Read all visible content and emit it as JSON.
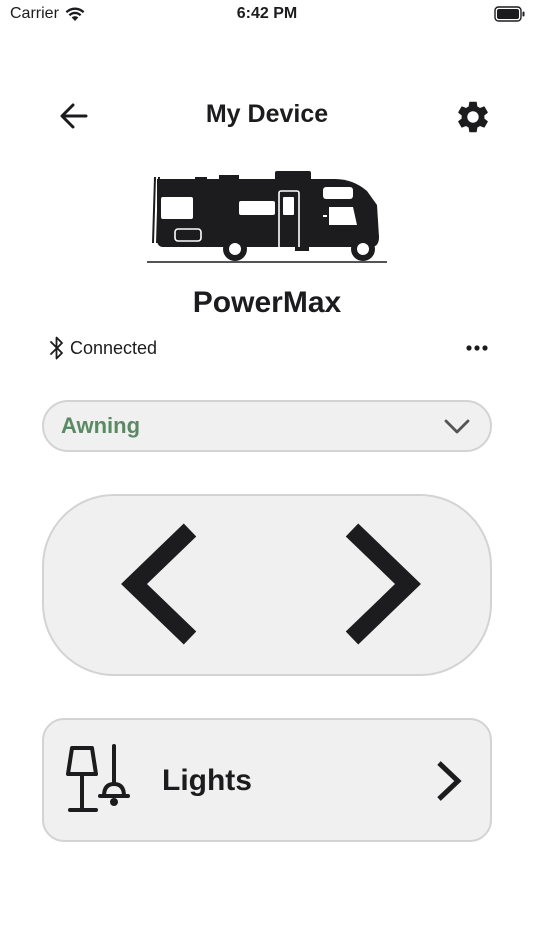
{
  "status_bar": {
    "carrier": "Carrier",
    "time": "6:42 PM"
  },
  "nav": {
    "title": "My Device",
    "back_icon": "arrow-left-icon",
    "settings_icon": "gear-icon"
  },
  "device": {
    "name": "PowerMax",
    "image_icon": "motorhome-icon",
    "connection_status": "Connected",
    "connection_icon": "bluetooth-icon",
    "more_icon": "more-horizontal-icon"
  },
  "selector": {
    "selected": "Awning",
    "chevron_icon": "chevron-down-icon"
  },
  "controls": {
    "left_icon": "chevron-left-icon",
    "right_icon": "chevron-right-icon"
  },
  "lights": {
    "label": "Lights",
    "icon": "lamp-icon",
    "chevron_icon": "chevron-right-icon"
  },
  "colors": {
    "accent_green": "#5a8a63",
    "card_background": "#f0f0f0",
    "card_border": "#d3d3d3",
    "text": "#1c1c1e"
  }
}
